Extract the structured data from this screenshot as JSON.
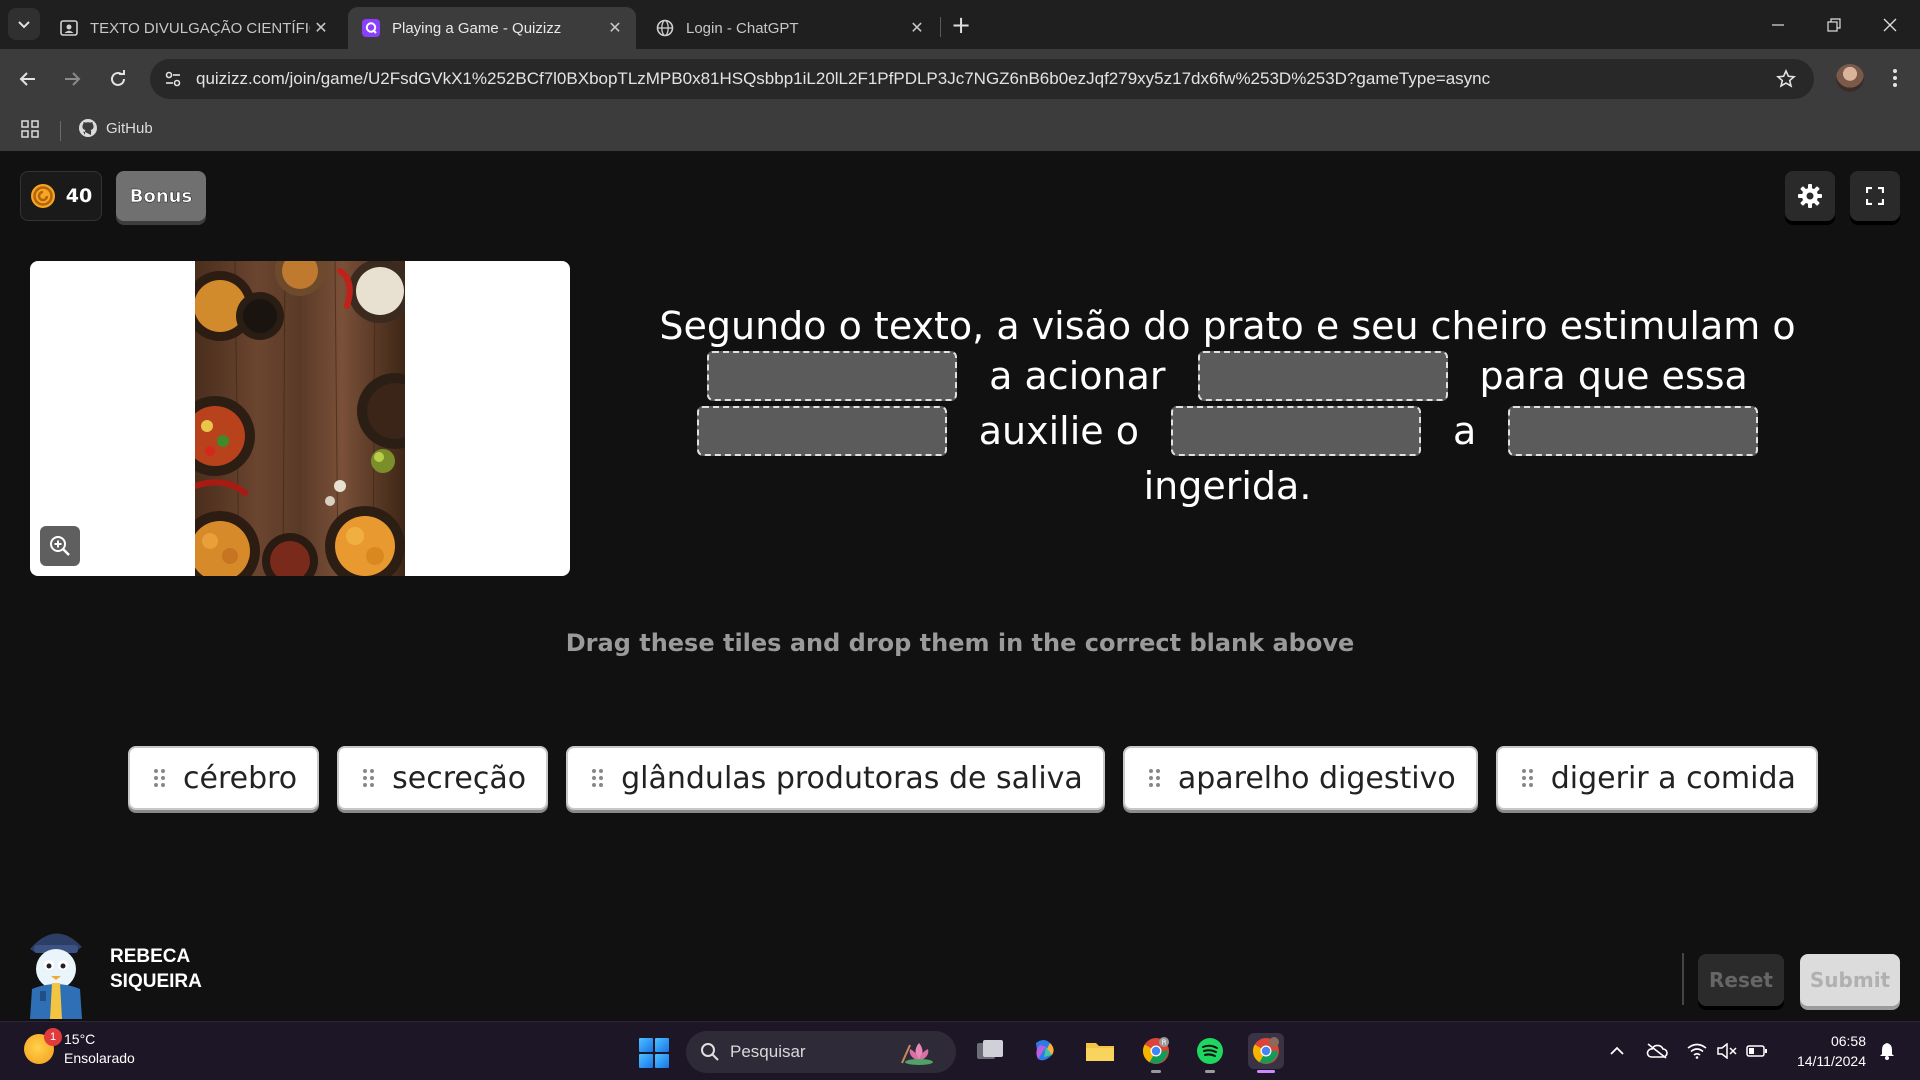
{
  "browser": {
    "tabs": [
      {
        "title": "TEXTO DIVULGAÇÃO CIENTÍFIC",
        "favicon": "classroom-icon",
        "active": false
      },
      {
        "title": "Playing a Game - Quizizz",
        "favicon": "quizizz-icon",
        "active": true
      },
      {
        "title": "Login - ChatGPT",
        "favicon": "globe-icon",
        "active": false
      }
    ],
    "url": "quizizz.com/join/game/U2FsdGVkX1%252BCf7l0BXbopTLzMPB0x81HSQsbbp1iL20lL2F1PfPDLP3Jc7NGZ6nB6b0ezJqf279xy5z17dx6fw%253D%253D?gameType=async",
    "bookmarks": [
      {
        "label": "GitHub",
        "icon": "github-icon"
      }
    ]
  },
  "game": {
    "coins": "40",
    "bonus_label": "Bonus",
    "question": {
      "line1": "Segundo o texto, a visão do prato e seu cheiro estimulam o",
      "w_acionar": "a acionar",
      "w_para": "para que essa",
      "w_auxilie": "auxilie o",
      "w_a": "a",
      "line4": "ingerida."
    },
    "instruction": "Drag these tiles and drop them in the correct blank above",
    "tiles": [
      "cérebro",
      "secreção",
      "glândulas produtoras de saliva",
      "aparelho digestivo",
      "digerir a comida"
    ],
    "player": {
      "first": "REBECA",
      "last": "SIQUEIRA"
    },
    "reset_label": "Reset",
    "submit_label": "Submit"
  },
  "taskbar": {
    "weather_temp": "15°C",
    "weather_desc": "Ensolarado",
    "weather_alert": "1",
    "search_placeholder": "Pesquisar",
    "time": "06:58",
    "date": "14/11/2024"
  },
  "colors": {
    "page_bg": "#111111",
    "blank_fill": "#5b5b5b",
    "tile_bg": "#ffffff",
    "coin": "#f5a623",
    "taskbar_bg": "#1c1626"
  }
}
